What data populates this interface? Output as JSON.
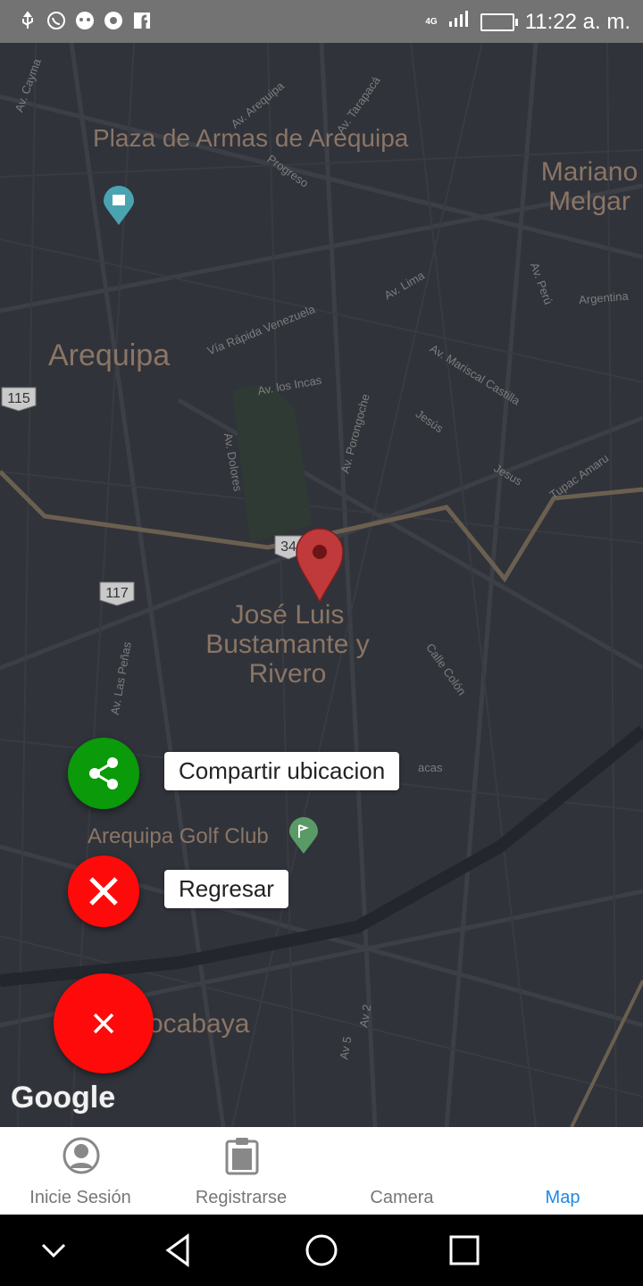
{
  "status_bar": {
    "time": "11:22 a. m.",
    "network": "4G"
  },
  "map": {
    "labels": {
      "plaza": "Plaza de Armas de Arequipa",
      "mariano": "Mariano Melgar",
      "arequipa": "Arequipa",
      "jose": "José Luis Bustamante y Rivero",
      "golf": "Arequipa Golf Club",
      "socabaya": "ocabaya"
    },
    "streets": {
      "cayma": "Av. Cayma",
      "arequipa_av": "Av. Arequipa",
      "tarapaca": "Av. Tarapacá",
      "progreso": "Progreso",
      "peru": "Av. Perú",
      "argentina": "Argentina",
      "lima": "Av. Lima",
      "venezuela": "Vía Rápida Venezuela",
      "mariscal": "Av. Mariscal Castilla",
      "incas": "Av. los Incas",
      "jesus1": "Jesús",
      "jesus2": "Jesus",
      "tupac": "Tupac Amaru",
      "porongoche": "Av. Porongoche",
      "dolores": "Av. Dolores",
      "colon": "Calle Colón",
      "penas": "Av. Las Peñas",
      "acas": "acas",
      "av2": "Av 2",
      "av5": "Av 5"
    },
    "route_shields": {
      "r115": "115",
      "r34": "34",
      "r117": "117"
    },
    "attribution": "Google"
  },
  "actions": {
    "share_label": "Compartir ubicacion",
    "back_label": "Regresar"
  },
  "tabs": [
    {
      "label": "Inicie Sesión"
    },
    {
      "label": "Registrarse"
    },
    {
      "label": "Camera"
    },
    {
      "label": "Map"
    }
  ],
  "colors": {
    "accent": "#1e88e5",
    "share": "#0a9a0a",
    "close": "#ff0a0a",
    "pin": "#c0393b"
  }
}
